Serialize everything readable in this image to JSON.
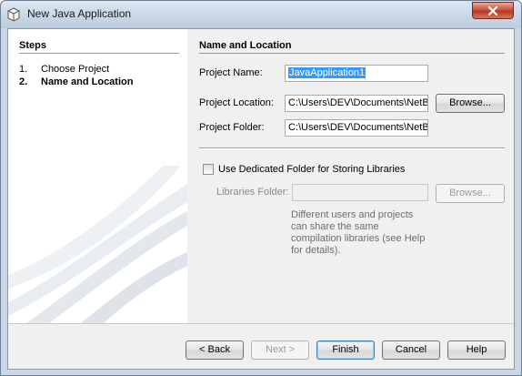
{
  "window": {
    "title": "New Java Application"
  },
  "steps": {
    "title": "Steps",
    "items": [
      {
        "num": "1.",
        "label": "Choose Project"
      },
      {
        "num": "2.",
        "label": "Name and Location"
      }
    ]
  },
  "main": {
    "title": "Name and Location",
    "project_name": {
      "label": "Project Name:",
      "value": "JavaApplication1"
    },
    "project_location": {
      "label": "Project Location:",
      "value": "C:\\Users\\DEV\\Documents\\NetBe",
      "browse": "Browse..."
    },
    "project_folder": {
      "label": "Project Folder:",
      "value": "C:\\Users\\DEV\\Documents\\NetBe"
    },
    "use_dedicated": {
      "label": "Use Dedicated Folder for Storing Libraries",
      "checked": false
    },
    "libraries_folder": {
      "label": "Libraries Folder:",
      "value": "",
      "browse": "Browse..."
    },
    "help_text": "Different users and projects can share the same compilation libraries (see Help for details)."
  },
  "buttons": {
    "back": "< Back",
    "next": "Next >",
    "finish": "Finish",
    "cancel": "Cancel",
    "help": "Help"
  },
  "colors": {
    "selection": "#3399ff",
    "close_button": "#c75640"
  }
}
